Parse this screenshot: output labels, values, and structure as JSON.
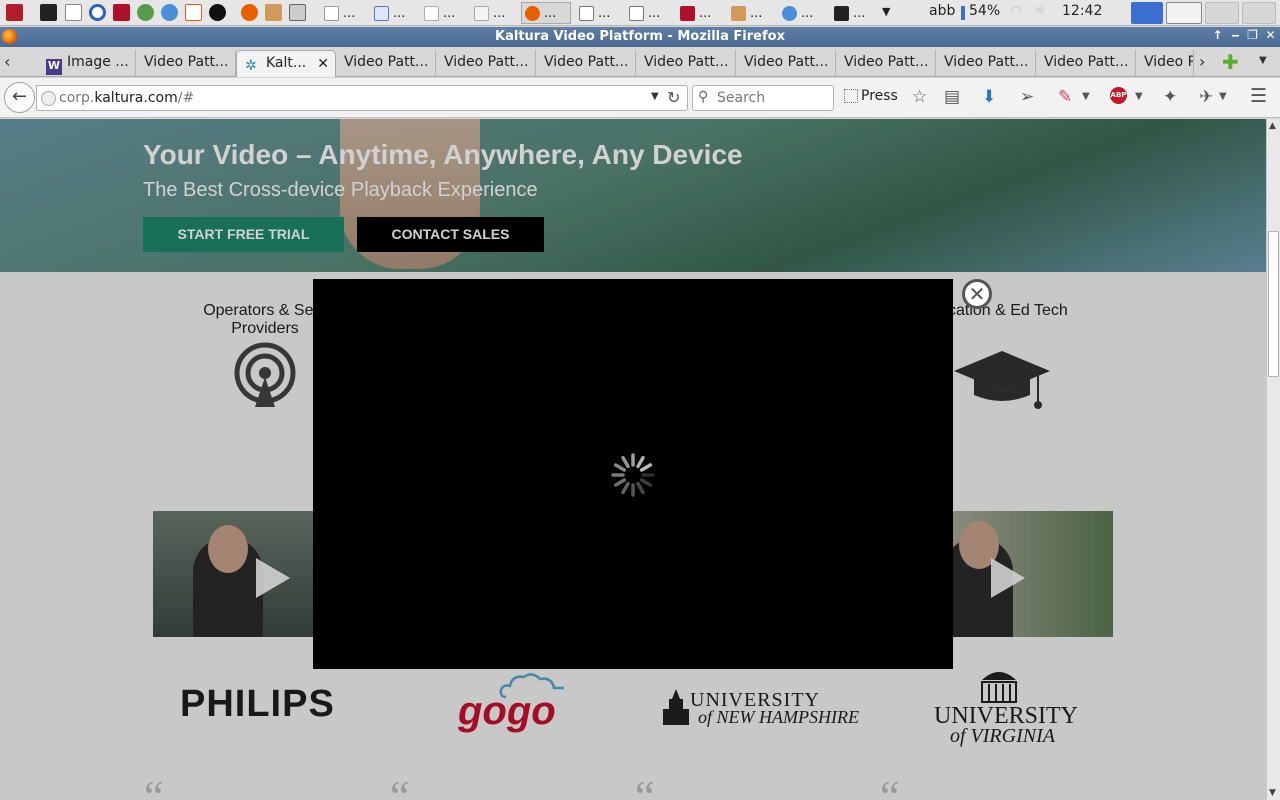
{
  "taskbar": {
    "windows": [
      "...",
      "...",
      "...",
      "...",
      "...",
      "...",
      "...",
      "...",
      "...",
      "...",
      "...",
      "..."
    ],
    "tray": {
      "user": "abb",
      "battery": "54%",
      "clock": "12:42"
    }
  },
  "titlebar": {
    "title": "Kaltura Video Platform - Mozilla Firefox"
  },
  "tabs": [
    {
      "label": "Image ..."
    },
    {
      "label": "Video Patt..."
    },
    {
      "label": "Kalt..."
    },
    {
      "label": "Video Patt..."
    },
    {
      "label": "Video Patt..."
    },
    {
      "label": "Video Patt..."
    },
    {
      "label": "Video Patt..."
    },
    {
      "label": "Video Patt..."
    },
    {
      "label": "Video Patt..."
    },
    {
      "label": "Video Patt..."
    },
    {
      "label": "Video Patt..."
    },
    {
      "label": "Video P"
    }
  ],
  "navbar": {
    "url_prefix": "corp.",
    "url_host": "kaltura.com",
    "url_path": "/#",
    "search_placeholder": "Search",
    "press_label": "Press"
  },
  "hero": {
    "headline": "Your Video – Anytime, Anywhere, Any Device",
    "subheadline": "The Best Cross-device Playback Experience",
    "trial_button": "START FREE TRIAL",
    "sales_button": "CONTACT SALES"
  },
  "segments": {
    "operators": "Operators & Serv Providers",
    "education": "cation & Ed Tech"
  },
  "logos": {
    "philips": "PHILIPS",
    "gogo": "gogo",
    "unh_line1": "UNIVERSITY",
    "unh_line2": "of NEW HAMPSHIRE",
    "uva_line1": "UNIVERSITY",
    "uva_line2": "of VIRGINIA"
  },
  "quote_mark": "“",
  "modal": {
    "close_glyph": "✕"
  },
  "colors": {
    "trial_button": "#1e8a6a",
    "sales_button": "#000000",
    "gogo_red": "#c8102e",
    "gogo_cloud": "#5aa7c8",
    "titlebar": "#5577a0"
  }
}
